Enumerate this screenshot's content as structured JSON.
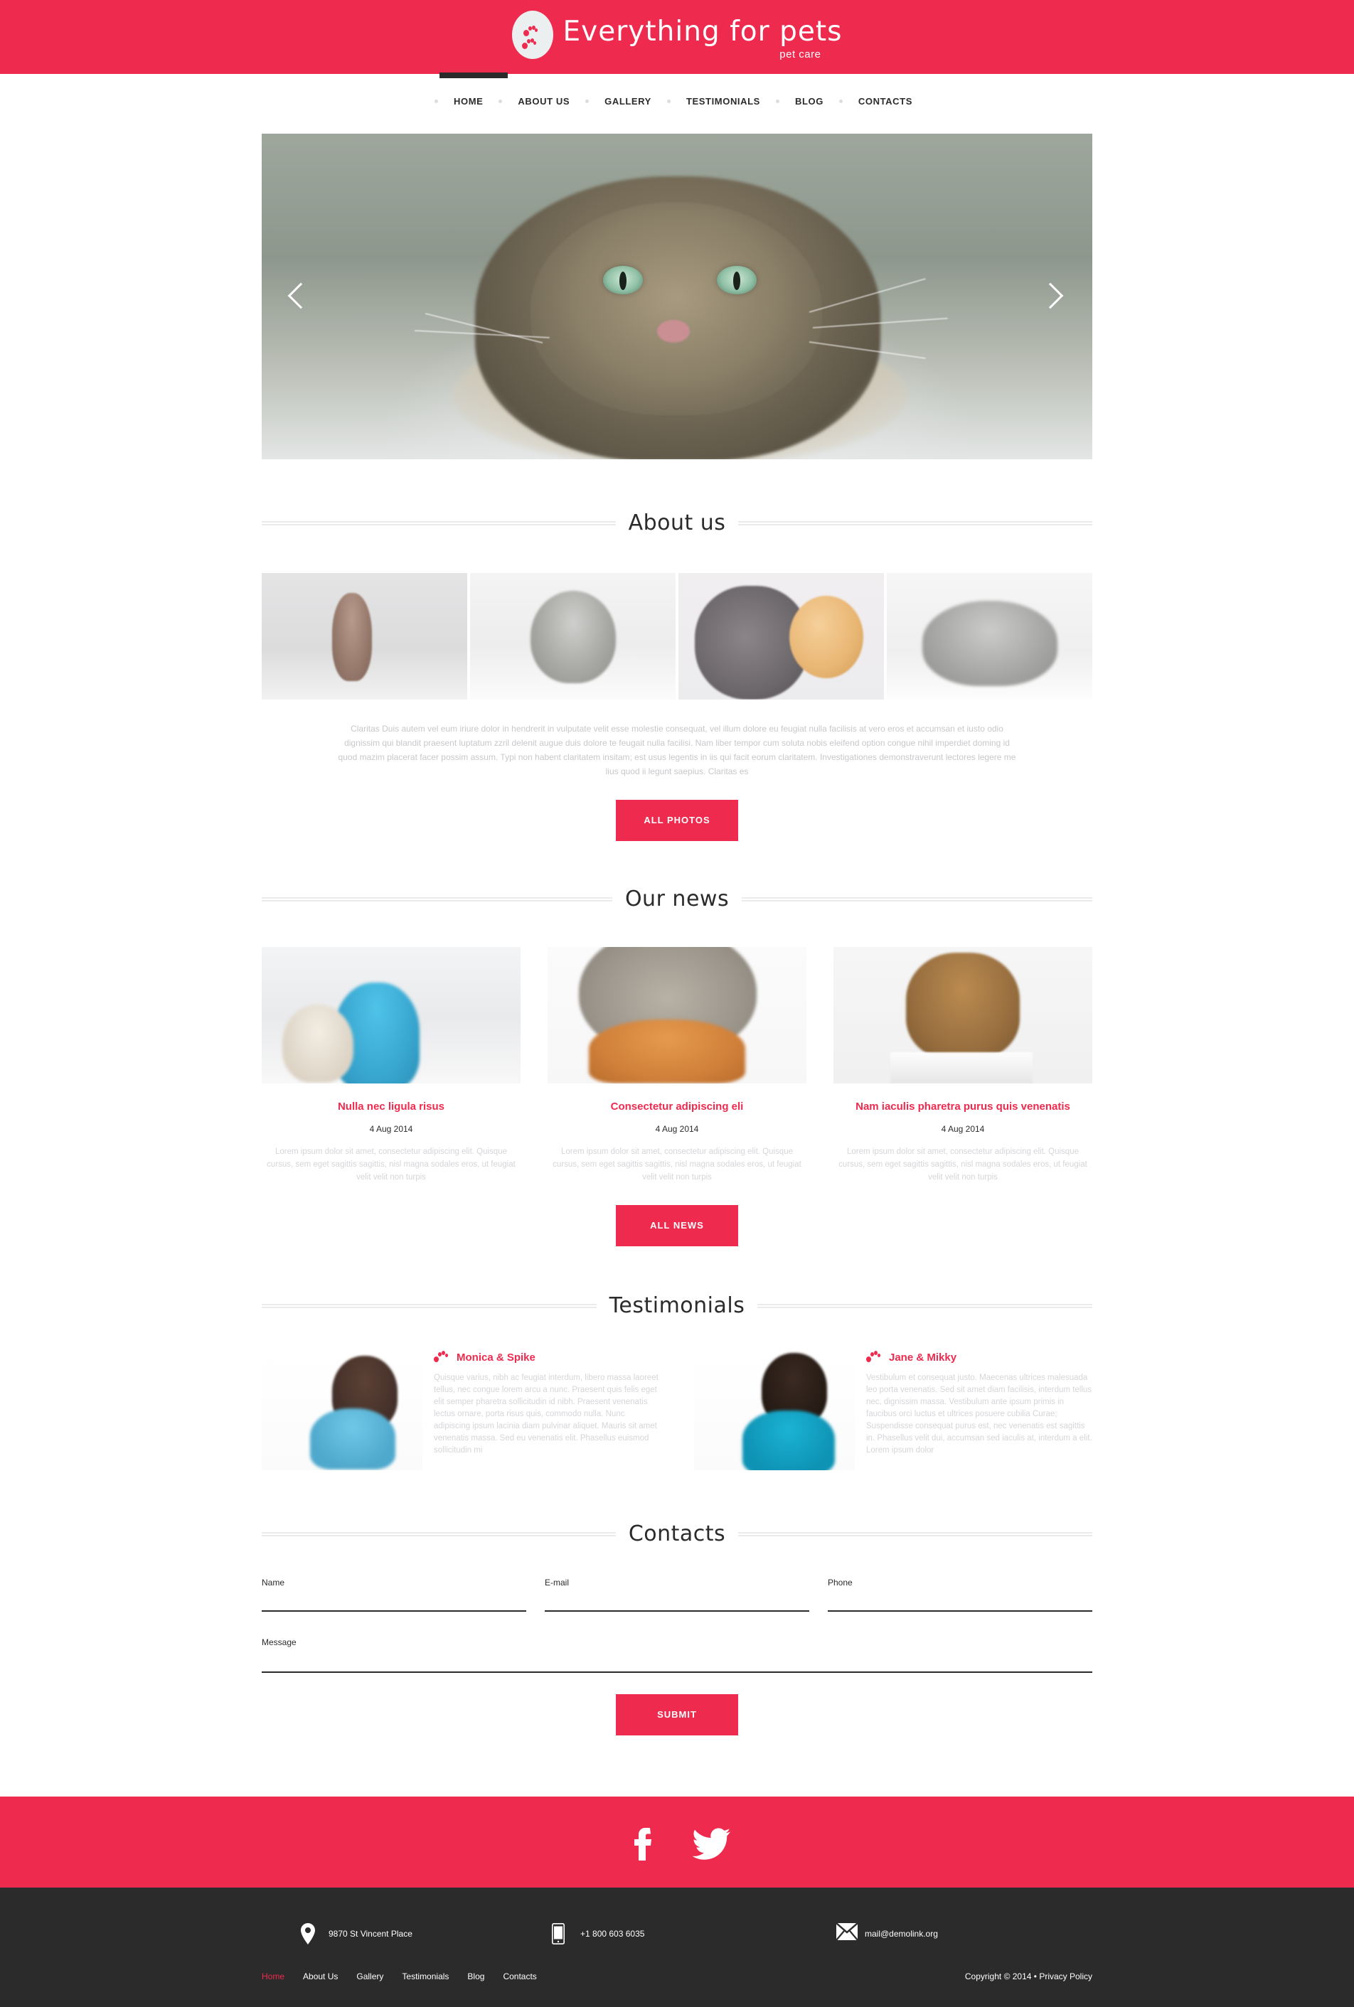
{
  "brand": {
    "name": "Everything for pets",
    "tagline": "pet care",
    "logo_icon": "paw-print-icon",
    "accent_color": "#ee2a4e",
    "dark_color": "#2b2b2b"
  },
  "nav": {
    "items": [
      {
        "label": "HOME",
        "active": true
      },
      {
        "label": "ABOUT US",
        "active": false
      },
      {
        "label": "GALLERY",
        "active": false
      },
      {
        "label": "TESTIMONIALS",
        "active": false
      },
      {
        "label": "BLOG",
        "active": false
      },
      {
        "label": "CONTACTS",
        "active": false
      }
    ]
  },
  "slider": {
    "prev_icon": "chevron-left-icon",
    "next_icon": "chevron-right-icon",
    "slide_alt": "fluffy tabby cat lying down"
  },
  "about": {
    "title": "About us",
    "photos": [
      {
        "alt": "sphynx kitten yawning"
      },
      {
        "alt": "grey persian kitten"
      },
      {
        "alt": "grey cat with ball of yarn"
      },
      {
        "alt": "sleeping fluffy kitten"
      }
    ],
    "text": "Claritas Duis autem vel eum iriure dolor in hendrerit in vulputate velit esse molestie consequat, vel illum dolore eu feugiat nulla facilisis at vero eros et accumsan et iusto odio dignissim qui blandit praesent luptatum zzril delenit augue duis dolore te feugait nulla facilisi. Nam liber tempor cum soluta nobis eleifend option congue nihil imperdiet doming id quod mazim placerat facer possim assum. Typi non habent claritatem insitam; est usus legentis in iis qui facit eorum claritatem. Investigationes demonstraverunt lectores legere me lius quod ii legunt saepius. Claritas es",
    "button_label": "ALL PHOTOS"
  },
  "news": {
    "title": "Our news",
    "items": [
      {
        "title": "Nulla nec ligula risus",
        "date": "4 Aug 2014",
        "text": "Lorem ipsum dolor sit amet, consectetur adipiscing elit. Quisque cursus, sem eget sagittis sagittis, nisl magna sodales eros, ut feugiat velit velit non turpis",
        "alt": "children with vet and small dog"
      },
      {
        "title": "Consectetur adipiscing eli",
        "date": "4 Aug 2014",
        "text": "Lorem ipsum dolor sit amet, consectetur adipiscing elit. Quisque cursus, sem eget sagittis sagittis, nisl magna sodales eros, ut feugiat velit velit non turpis",
        "alt": "cat eating dry food"
      },
      {
        "title": "Nam iaculis pharetra purus quis venenatis",
        "date": "4 Aug 2014",
        "text": "Lorem ipsum dolor sit amet, consectetur adipiscing elit. Quisque cursus, sem eget sagittis sagittis, nisl magna sodales eros, ut feugiat velit velit non turpis",
        "alt": "dog barking with open mouth"
      }
    ],
    "button_label": "ALL NEWS"
  },
  "testimonials": {
    "title": "Testimonials",
    "items": [
      {
        "name": "Monica & Spike",
        "icon": "paw-print-icon",
        "text": "Quisque varius, nibh ac feugiat interdum, libero massa laoreet tellus, nec congue lorem arcu a nunc. Praesent quis felis eget elit semper pharetra sollicitudin id nibh. Praesent venenatis lectus ornare, porta risus quis, commodo nulla. Nunc adipiscing ipsum lacinia diam pulvinar aliquet. Mauris sit amet venenatis massa. Sed eu venenatis elit. Phasellus euismod sollicitudin mi",
        "alt": "woman holding small terrier dog"
      },
      {
        "name": "Jane & Mikky",
        "icon": "paw-print-icon",
        "text": "Vestibulum et consequat justo. Maecenas ultrices malesuada leo porta venenatis. Sed sit amet diam facilisis, interdum tellus nec, dignissim massa. Vestibulum ante ipsum primis in faucibus orci luctus et ultrices posuere cubilia Curae; Suspendisse consequat purus est, nec venenatis est sagittis in. Phasellus velit dui, accumsan sed iaculis at, interdum a elit. Lorem ipsum dolor",
        "alt": "woman in blue shirt holding yorkshire terrier"
      }
    ]
  },
  "contacts": {
    "title": "Contacts",
    "fields": {
      "name_label": "Name",
      "name_value": "",
      "email_label": "E-mail",
      "email_value": "",
      "phone_label": "Phone",
      "phone_value": "",
      "message_label": "Message",
      "message_value": ""
    },
    "submit_label": "SUBMIT"
  },
  "social": {
    "items": [
      {
        "name": "facebook-icon",
        "label": "Facebook"
      },
      {
        "name": "twitter-icon",
        "label": "Twitter"
      }
    ]
  },
  "footer": {
    "info": [
      {
        "icon": "map-pin-icon",
        "text": "9870 St Vincent Place"
      },
      {
        "icon": "phone-icon",
        "text": "+1 800 603 6035"
      },
      {
        "icon": "envelope-icon",
        "text": "mail@demolink.org"
      }
    ],
    "nav": [
      {
        "label": "Home",
        "active": true
      },
      {
        "label": "About Us",
        "active": false
      },
      {
        "label": "Gallery",
        "active": false
      },
      {
        "label": "Testimonials",
        "active": false
      },
      {
        "label": "Blog",
        "active": false
      },
      {
        "label": "Contacts",
        "active": false
      }
    ],
    "copyright_prefix": "Copyright © 2014 • ",
    "privacy_label": "Privacy Policy"
  }
}
